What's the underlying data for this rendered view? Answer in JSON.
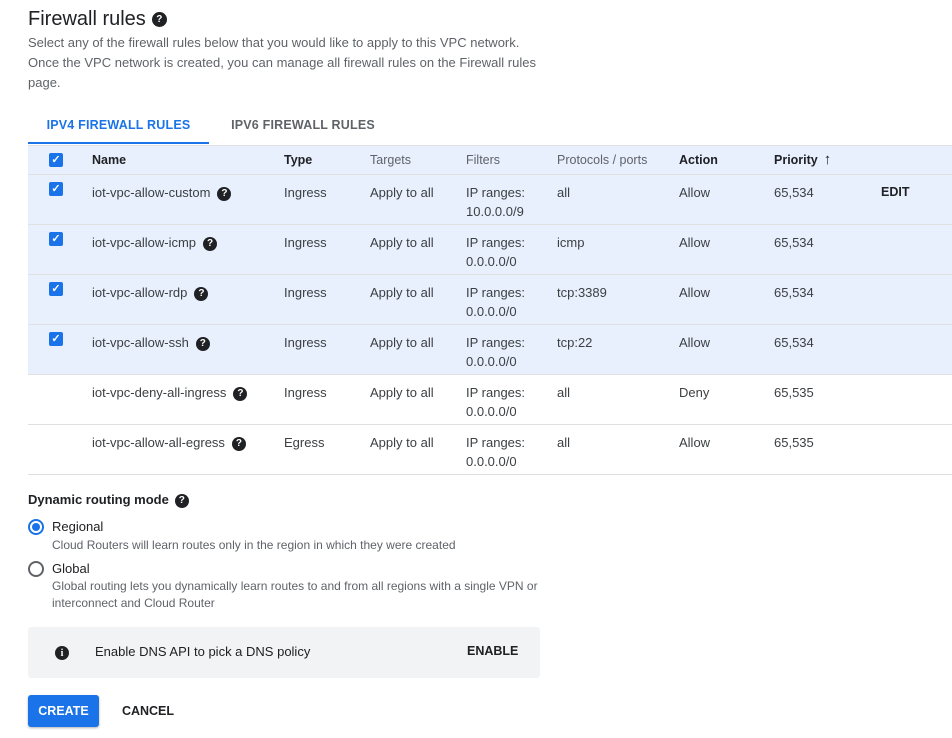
{
  "section": {
    "title": "Firewall rules",
    "help_icon": "?",
    "description": "Select any of the firewall rules below that you would like to apply to this VPC network. Once the VPC network is created, you can manage all firewall rules on the Firewall rules page."
  },
  "tabs": [
    {
      "label": "IPV4 FIREWALL RULES",
      "active": true
    },
    {
      "label": "IPV6 FIREWALL RULES",
      "active": false
    }
  ],
  "table": {
    "headers": {
      "name": "Name",
      "type": "Type",
      "targets": "Targets",
      "filters": "Filters",
      "protocols": "Protocols / ports",
      "action": "Action",
      "priority": "Priority",
      "sort_icon": "arrow-up-icon"
    },
    "header_checked": true,
    "edit_label": "EDIT",
    "rows": [
      {
        "checked": true,
        "name": "iot-vpc-allow-custom",
        "type": "Ingress",
        "targets": "Apply to all",
        "filters": "IP ranges: 10.0.0.0/9",
        "protocols": "all",
        "action": "Allow",
        "priority": "65,534"
      },
      {
        "checked": true,
        "name": "iot-vpc-allow-icmp",
        "type": "Ingress",
        "targets": "Apply to all",
        "filters": "IP ranges: 0.0.0.0/0",
        "protocols": "icmp",
        "action": "Allow",
        "priority": "65,534"
      },
      {
        "checked": true,
        "name": "iot-vpc-allow-rdp",
        "type": "Ingress",
        "targets": "Apply to all",
        "filters": "IP ranges: 0.0.0.0/0",
        "protocols": "tcp:3389",
        "action": "Allow",
        "priority": "65,534"
      },
      {
        "checked": true,
        "name": "iot-vpc-allow-ssh",
        "type": "Ingress",
        "targets": "Apply to all",
        "filters": "IP ranges: 0.0.0.0/0",
        "protocols": "tcp:22",
        "action": "Allow",
        "priority": "65,534"
      },
      {
        "checked": false,
        "name": "iot-vpc-deny-all-ingress",
        "type": "Ingress",
        "targets": "Apply to all",
        "filters": "IP ranges: 0.0.0.0/0",
        "protocols": "all",
        "action": "Deny",
        "priority": "65,535"
      },
      {
        "checked": false,
        "name": "iot-vpc-allow-all-egress",
        "type": "Egress",
        "targets": "Apply to all",
        "filters": "IP ranges: 0.0.0.0/0",
        "protocols": "all",
        "action": "Allow",
        "priority": "65,535"
      }
    ]
  },
  "routing": {
    "label": "Dynamic routing mode",
    "options": [
      {
        "label": "Regional",
        "description": "Cloud Routers will learn routes only in the region in which they were created",
        "selected": true
      },
      {
        "label": "Global",
        "description": "Global routing lets you dynamically learn routes to and from all regions with a single VPN or interconnect and Cloud Router",
        "selected": false
      }
    ]
  },
  "dns": {
    "icon": "info-icon",
    "message": "Enable DNS API to pick a DNS policy",
    "enable_label": "ENABLE"
  },
  "actions": {
    "create_label": "CREATE",
    "cancel_label": "CANCEL"
  },
  "colors": {
    "accent": "#1a73e8",
    "selected_row": "#e8f0fe",
    "info_box": "#f1f3f4"
  }
}
